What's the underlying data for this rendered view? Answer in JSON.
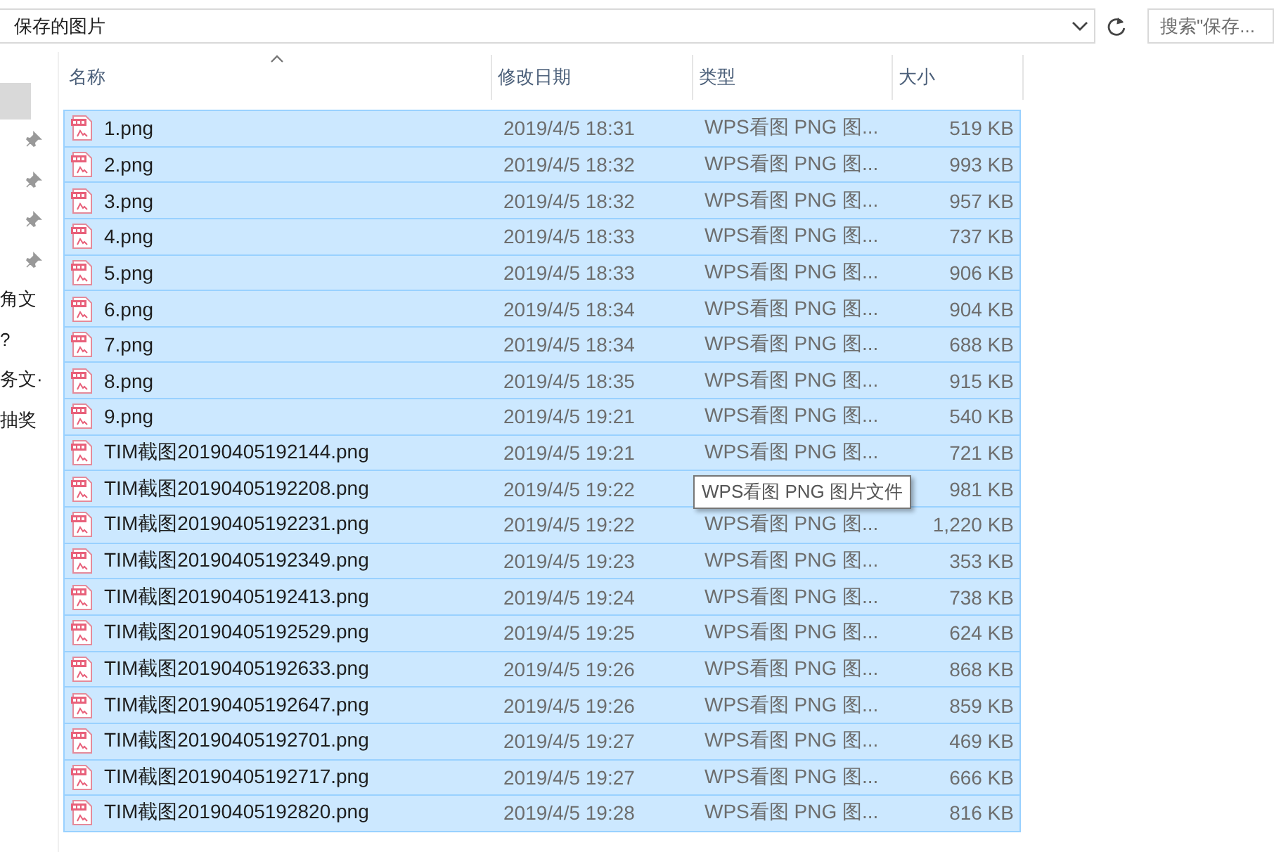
{
  "address_bar": {
    "path": "保存的图片"
  },
  "search": {
    "placeholder": "搜索\"保存..."
  },
  "nav_pane": {
    "items": [
      {
        "kind": "selected-blank",
        "selected": true
      },
      {
        "kind": "pin"
      },
      {
        "kind": "pin"
      },
      {
        "kind": "pin"
      },
      {
        "kind": "pin"
      },
      {
        "kind": "text",
        "label": "角文"
      },
      {
        "kind": "text",
        "label": "?"
      },
      {
        "kind": "text",
        "label": "务文·"
      },
      {
        "kind": "text",
        "label": "抽奖"
      }
    ]
  },
  "table": {
    "columns": [
      {
        "label": "名称",
        "sorted": true
      },
      {
        "label": "修改日期",
        "sorted": false
      },
      {
        "label": "类型",
        "sorted": false
      },
      {
        "label": "大小",
        "sorted": false
      }
    ],
    "rows": [
      {
        "name": "1.png",
        "date": "2019/4/5 18:31",
        "type": "WPS看图 PNG 图...",
        "size": "519 KB",
        "selected": true
      },
      {
        "name": "2.png",
        "date": "2019/4/5 18:32",
        "type": "WPS看图 PNG 图...",
        "size": "993 KB",
        "selected": true
      },
      {
        "name": "3.png",
        "date": "2019/4/5 18:32",
        "type": "WPS看图 PNG 图...",
        "size": "957 KB",
        "selected": true
      },
      {
        "name": "4.png",
        "date": "2019/4/5 18:33",
        "type": "WPS看图 PNG 图...",
        "size": "737 KB",
        "selected": true
      },
      {
        "name": "5.png",
        "date": "2019/4/5 18:33",
        "type": "WPS看图 PNG 图...",
        "size": "906 KB",
        "selected": true
      },
      {
        "name": "6.png",
        "date": "2019/4/5 18:34",
        "type": "WPS看图 PNG 图...",
        "size": "904 KB",
        "selected": true
      },
      {
        "name": "7.png",
        "date": "2019/4/5 18:34",
        "type": "WPS看图 PNG 图...",
        "size": "688 KB",
        "selected": true
      },
      {
        "name": "8.png",
        "date": "2019/4/5 18:35",
        "type": "WPS看图 PNG 图...",
        "size": "915 KB",
        "selected": true
      },
      {
        "name": "9.png",
        "date": "2019/4/5 19:21",
        "type": "WPS看图 PNG 图...",
        "size": "540 KB",
        "selected": true
      },
      {
        "name": "TIM截图20190405192144.png",
        "date": "2019/4/5 19:21",
        "type": "WPS看图 PNG 图...",
        "size": "721 KB",
        "selected": true
      },
      {
        "name": "TIM截图20190405192208.png",
        "date": "2019/4/5 19:22",
        "tooltip": "WPS看图 PNG 图片文件",
        "size": "981 KB",
        "selected": true
      },
      {
        "name": "TIM截图20190405192231.png",
        "date": "2019/4/5 19:22",
        "type": "WPS看图 PNG 图...",
        "size": "1,220 KB",
        "selected": true
      },
      {
        "name": "TIM截图20190405192349.png",
        "date": "2019/4/5 19:23",
        "type": "WPS看图 PNG 图...",
        "size": "353 KB",
        "selected": true
      },
      {
        "name": "TIM截图20190405192413.png",
        "date": "2019/4/5 19:24",
        "type": "WPS看图 PNG 图...",
        "size": "738 KB",
        "selected": true
      },
      {
        "name": "TIM截图20190405192529.png",
        "date": "2019/4/5 19:25",
        "type": "WPS看图 PNG 图...",
        "size": "624 KB",
        "selected": true
      },
      {
        "name": "TIM截图20190405192633.png",
        "date": "2019/4/5 19:26",
        "type": "WPS看图 PNG 图...",
        "size": "868 KB",
        "selected": true
      },
      {
        "name": "TIM截图20190405192647.png",
        "date": "2019/4/5 19:26",
        "type": "WPS看图 PNG 图...",
        "size": "859 KB",
        "selected": true
      },
      {
        "name": "TIM截图20190405192701.png",
        "date": "2019/4/5 19:27",
        "type": "WPS看图 PNG 图...",
        "size": "469 KB",
        "selected": true
      },
      {
        "name": "TIM截图20190405192717.png",
        "date": "2019/4/5 19:27",
        "type": "WPS看图 PNG 图...",
        "size": "666 KB",
        "selected": true
      },
      {
        "name": "TIM截图20190405192820.png",
        "date": "2019/4/5 19:28",
        "type": "WPS看图 PNG 图...",
        "size": "816 KB",
        "selected": true
      }
    ]
  }
}
